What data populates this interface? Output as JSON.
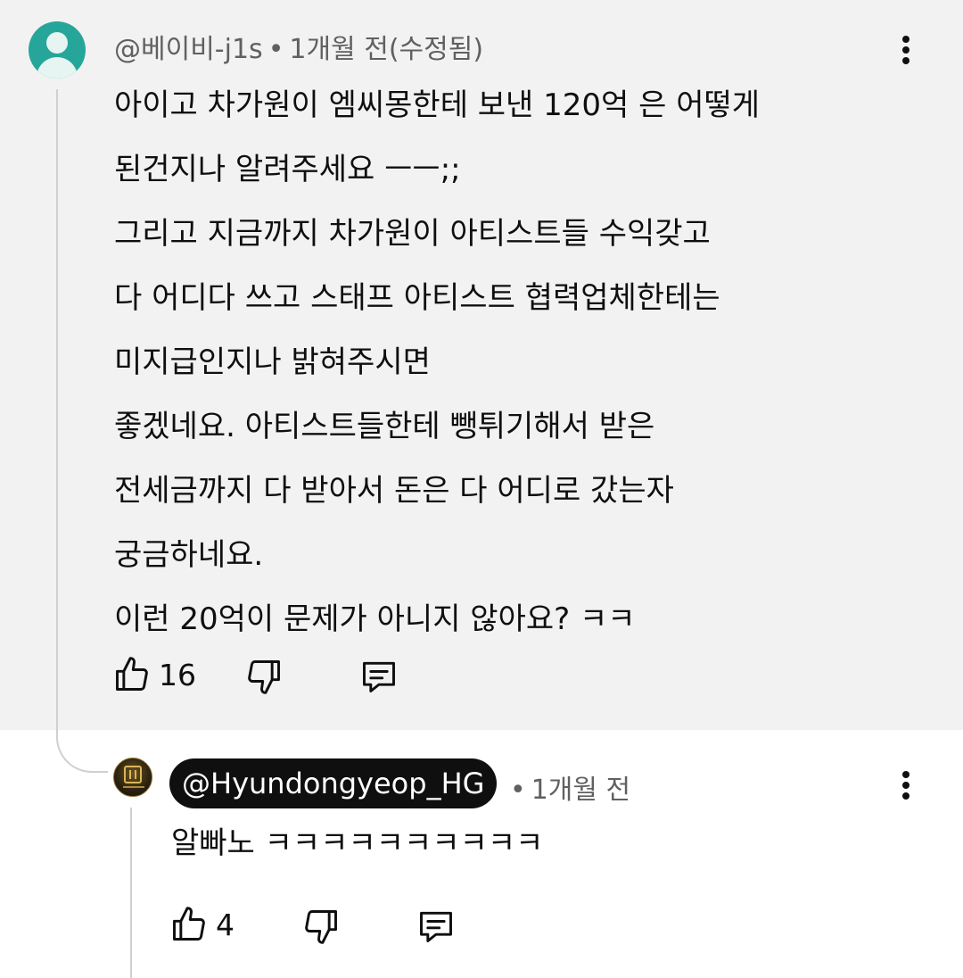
{
  "parent_comment": {
    "author": "@베이비-j1s",
    "separator": "•",
    "time": "1개월 전(수정됨)",
    "lines": [
      "아이고 차가원이 엠씨몽한테 보낸 120억 은 어떻게",
      "된건지나 알려주세요 ㅡㅡ;;",
      "그리고 지금까지 차가원이 아티스트들 수익갖고",
      "다 어디다 쓰고 스태프 아티스트 협력업체한테는",
      "미지급인지나 밝혀주시면",
      "좋겠네요. 아티스트들한테 뺑튀기해서 받은",
      "전세금까지 다 받아서 돈은 다 어디로 갔는자",
      "궁금하네요.",
      "이런 20억이 문제가 아니지 않아요? ㅋㅋ"
    ],
    "like_count": "16",
    "avatar_icon": "default-person-avatar",
    "avatar_color": "#26a69a"
  },
  "reply_comment": {
    "author": "@Hyundongyeop_HG",
    "separator": "•",
    "time": "1개월 전",
    "text": "알빠노 ㅋㅋㅋㅋㅋㅋㅋㅋㅋㅋ",
    "like_count": "4",
    "avatar_icon": "channel-logo-avatar",
    "author_pill_color": "#0f0f0f"
  },
  "icons": {
    "like": "thumbs-up-icon",
    "dislike": "thumbs-down-icon",
    "reply": "reply-comment-icon",
    "menu": "more-vert-icon"
  },
  "colors": {
    "parent_background": "#f2f2f2",
    "meta_text": "#606060",
    "thread_line": "#d0d0d0"
  }
}
